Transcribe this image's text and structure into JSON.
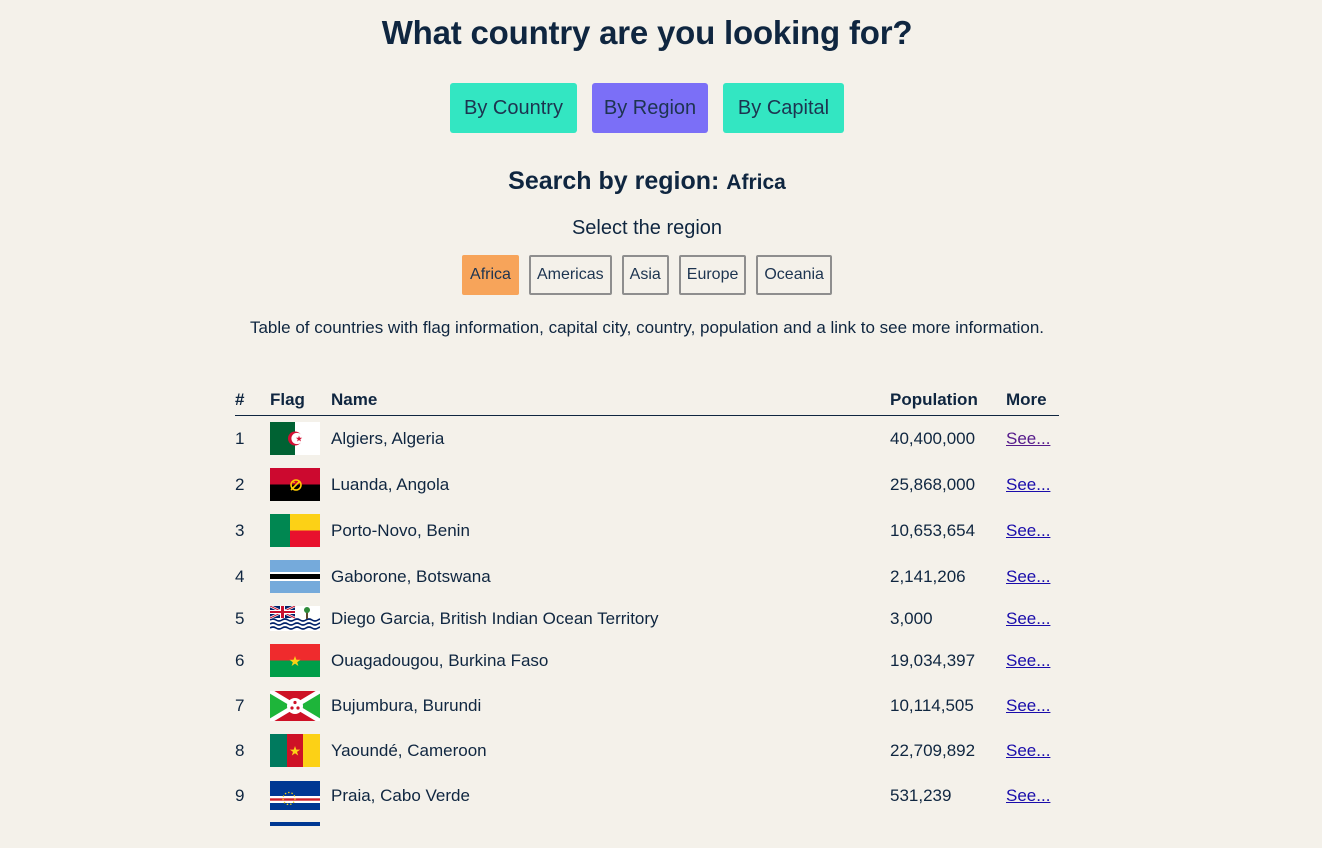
{
  "page_title": "What country are you looking for?",
  "mode_buttons": [
    {
      "label": "By Country",
      "color": "#33e6c2"
    },
    {
      "label": "By Region",
      "color": "#7b6ff7",
      "active": true
    },
    {
      "label": "By Capital",
      "color": "#33e6c2"
    }
  ],
  "search": {
    "heading": "Search by region:",
    "region": "Africa"
  },
  "select_label": "Select the region",
  "regions": [
    {
      "label": "Africa",
      "active": true
    },
    {
      "label": "Americas"
    },
    {
      "label": "Asia"
    },
    {
      "label": "Europe"
    },
    {
      "label": "Oceania"
    }
  ],
  "table_caption": "Table of countries with flag information, capital city, country, population and a link to see more information.",
  "table": {
    "headers": {
      "index": "#",
      "flag": "Flag",
      "name": "Name",
      "population": "Population",
      "more": "More"
    },
    "rows": [
      {
        "index": "1",
        "flag": "algeria-flag-icon",
        "name": "Algiers, Algeria",
        "population": "40,400,000",
        "more": "See..."
      },
      {
        "index": "2",
        "flag": "angola-flag-icon",
        "name": "Luanda, Angola",
        "population": "25,868,000",
        "more": "See..."
      },
      {
        "index": "3",
        "flag": "benin-flag-icon",
        "name": "Porto-Novo, Benin",
        "population": "10,653,654",
        "more": "See..."
      },
      {
        "index": "4",
        "flag": "botswana-flag-icon",
        "name": "Gaborone, Botswana",
        "population": "2,141,206",
        "more": "See..."
      },
      {
        "index": "5",
        "flag": "british-indian-ocean-territory-flag-icon",
        "name": "Diego Garcia, British Indian Ocean Territory",
        "population": "3,000",
        "more": "See..."
      },
      {
        "index": "6",
        "flag": "burkina-faso-flag-icon",
        "name": "Ouagadougou, Burkina Faso",
        "population": "19,034,397",
        "more": "See..."
      },
      {
        "index": "7",
        "flag": "burundi-flag-icon",
        "name": "Bujumbura, Burundi",
        "population": "10,114,505",
        "more": "See..."
      },
      {
        "index": "8",
        "flag": "cameroon-flag-icon",
        "name": "Yaoundé, Cameroon",
        "population": "22,709,892",
        "more": "See..."
      },
      {
        "index": "9",
        "flag": "cabo-verde-flag-icon",
        "name": "Praia, Cabo Verde",
        "population": "531,239",
        "more": "See..."
      }
    ]
  },
  "colors": {
    "background": "#f4f1ea",
    "text": "#0f2640",
    "accent_teal": "#33e6c2",
    "accent_purple": "#7b6ff7",
    "active_region": "#f7a45a",
    "link": "#1a0dab",
    "link_visited": "#551a8b"
  }
}
